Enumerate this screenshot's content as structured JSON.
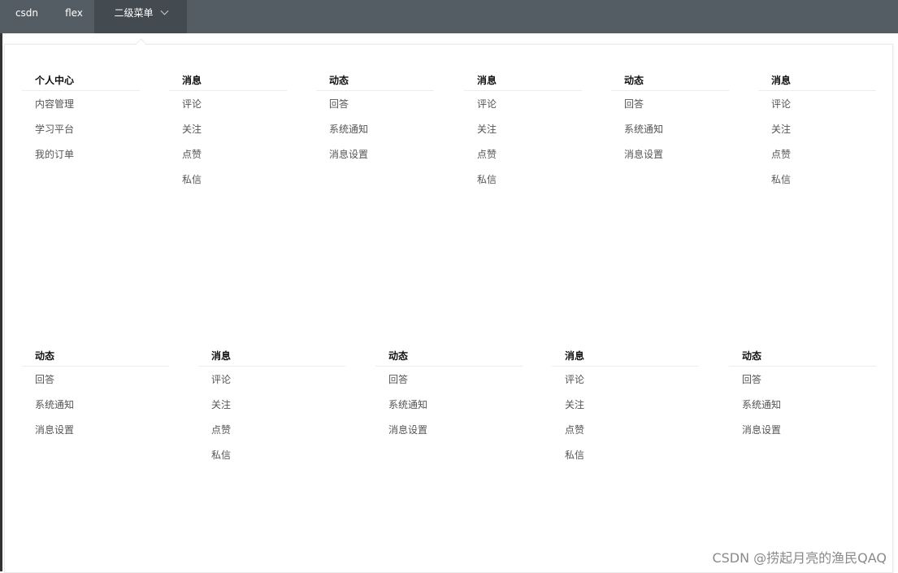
{
  "nav": {
    "items": [
      {
        "label": "csdn"
      },
      {
        "label": "flex"
      },
      {
        "label": "二级菜单"
      }
    ]
  },
  "menu": {
    "row1": [
      {
        "title": "个人中心",
        "items": [
          "内容管理",
          "学习平台",
          "我的订单"
        ]
      },
      {
        "title": "消息",
        "items": [
          "评论",
          "关注",
          "点赞",
          "私信"
        ]
      },
      {
        "title": "动态",
        "items": [
          "回答",
          "系统通知",
          "消息设置"
        ]
      },
      {
        "title": "消息",
        "items": [
          "评论",
          "关注",
          "点赞",
          "私信"
        ]
      },
      {
        "title": "动态",
        "items": [
          "回答",
          "系统通知",
          "消息设置"
        ]
      },
      {
        "title": "消息",
        "items": [
          "评论",
          "关注",
          "点赞",
          "私信"
        ]
      }
    ],
    "row2": [
      {
        "title": "动态",
        "items": [
          "回答",
          "系统通知",
          "消息设置"
        ]
      },
      {
        "title": "消息",
        "items": [
          "评论",
          "关注",
          "点赞",
          "私信"
        ]
      },
      {
        "title": "动态",
        "items": [
          "回答",
          "系统通知",
          "消息设置"
        ]
      },
      {
        "title": "消息",
        "items": [
          "评论",
          "关注",
          "点赞",
          "私信"
        ]
      },
      {
        "title": "动态",
        "items": [
          "回答",
          "系统通知",
          "消息设置"
        ]
      }
    ]
  },
  "watermark": "CSDN @捞起月亮的渔民QAQ"
}
